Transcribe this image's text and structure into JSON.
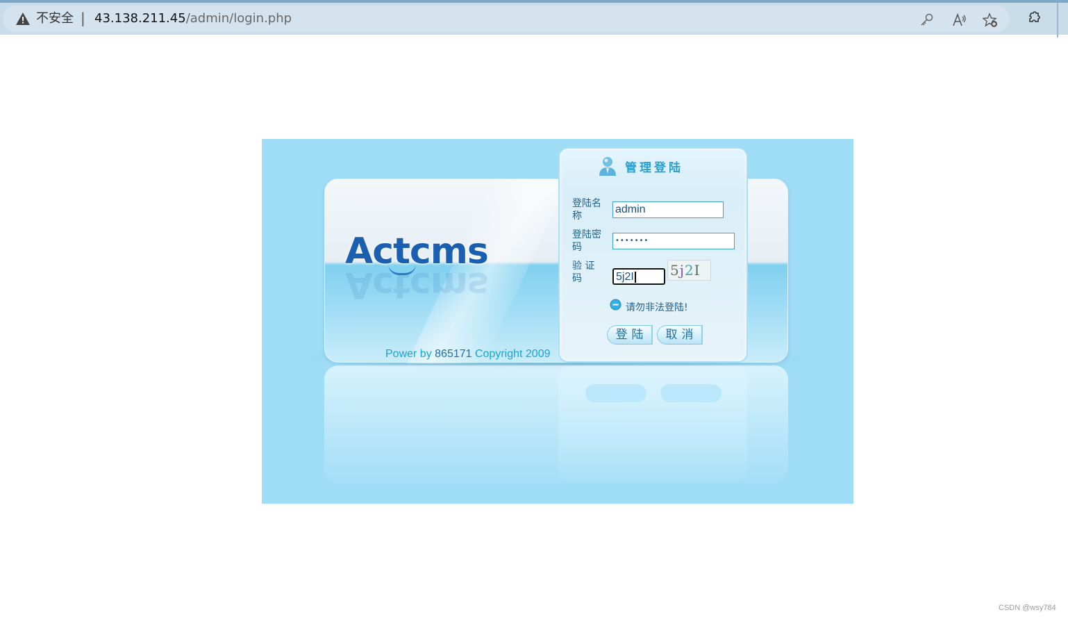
{
  "browser": {
    "security_label": "不安全",
    "separator": "|",
    "url_host": "43.138.211.45",
    "url_path": "/admin/login.php",
    "icons": [
      "warning-icon",
      "key-icon",
      "read-aloud-icon",
      "favorite-add-icon",
      "extensions-icon"
    ]
  },
  "banner": {
    "logo_text": "Actcms",
    "powered_prefix": "Power by ",
    "powered_number": "865171",
    "powered_suffix": " Copyright 2009"
  },
  "login": {
    "title": "管理登陆",
    "username_label": "登陆名称",
    "username_value": "admin",
    "password_label": "登陆密码",
    "password_value": "•••••••",
    "captcha_label": "验 证 码",
    "captcha_value": "5j2I",
    "captcha_image_chars": [
      "5",
      "j",
      "2",
      "I"
    ],
    "notice": "请勿非法登陆!",
    "login_button": "登陆",
    "cancel_button": "取消"
  },
  "watermark": "CSDN @wsy784",
  "colors": {
    "banner_bg": "#9fdcf6",
    "accent": "#2a9fd0",
    "label_text": "#18638f",
    "logo": "#1a5fb0",
    "browser_bar": "#c9dcea"
  }
}
